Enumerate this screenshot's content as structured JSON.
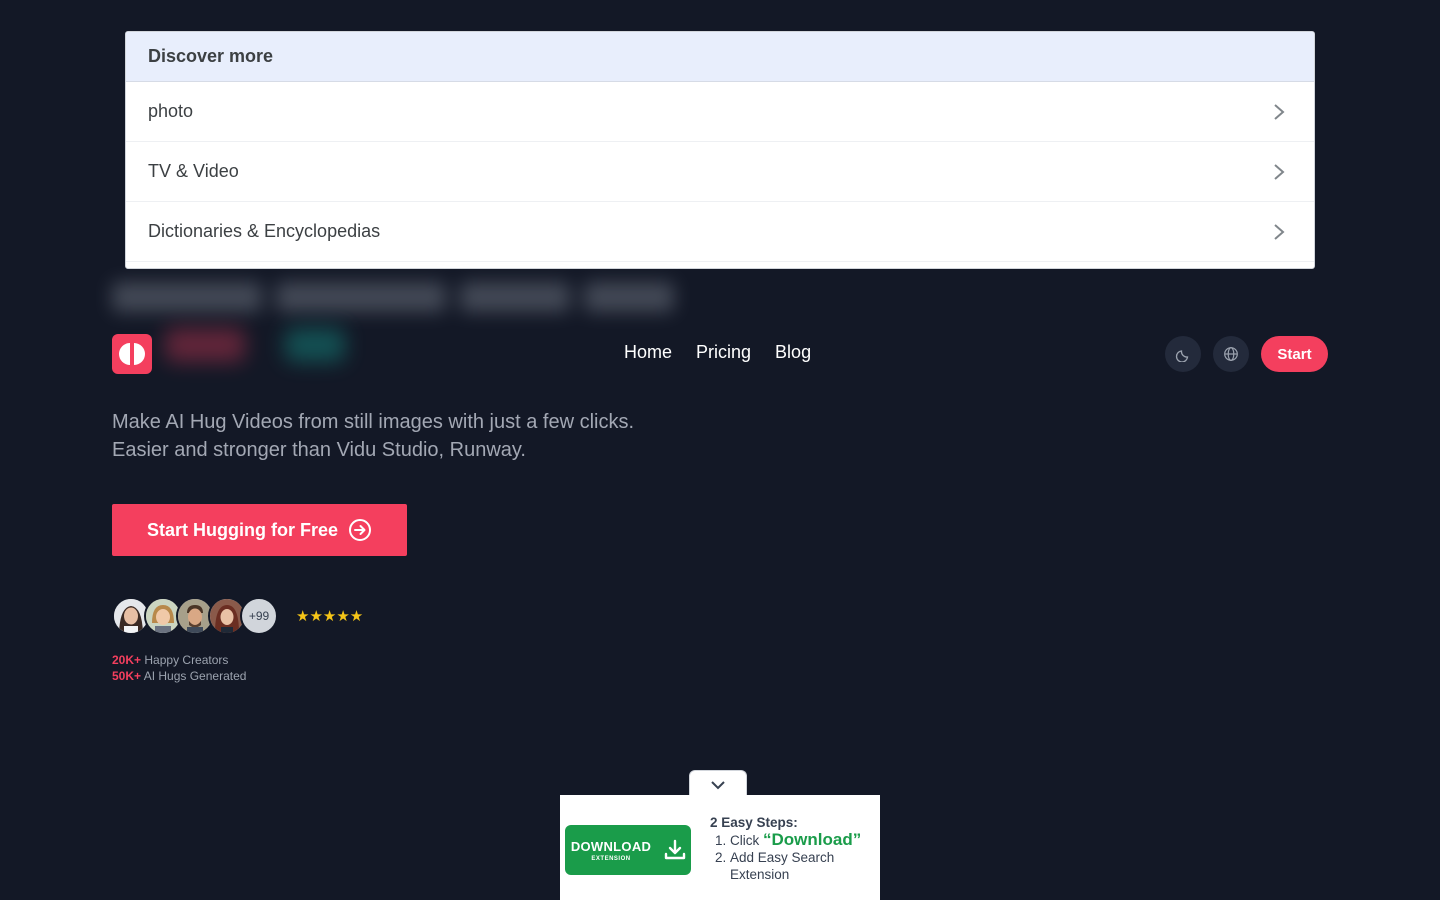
{
  "discover": {
    "title": "Discover more",
    "items": [
      {
        "label": "photo"
      },
      {
        "label": "TV & Video"
      },
      {
        "label": "Dictionaries & Encyclopedias"
      }
    ]
  },
  "nav": {
    "links": [
      "Home",
      "Pricing",
      "Blog"
    ],
    "start_label": "Start"
  },
  "hero": {
    "tagline_line1": "Make AI Hug Videos from still images with just a few clicks.",
    "tagline_line2": "Easier and stronger than Vidu Studio, Runway.",
    "cta_label": "Start Hugging for Free",
    "avatar_more": "+99",
    "stars": "★★★★★",
    "stat1_value": "20K+",
    "stat1_label": "Happy Creators",
    "stat2_value": "50K+",
    "stat2_label": "AI Hugs Generated"
  },
  "banner": {
    "download_label": "DOWNLOAD",
    "download_sub": "EXTENSION",
    "steps_title": "2 Easy Steps:",
    "step1_prefix": "Click ",
    "step1_highlight": "“Download”",
    "step2": "Add Easy Search Extension"
  },
  "colors": {
    "background": "#131826",
    "accent": "#f43f5e",
    "download_green": "#1a9c4a"
  }
}
